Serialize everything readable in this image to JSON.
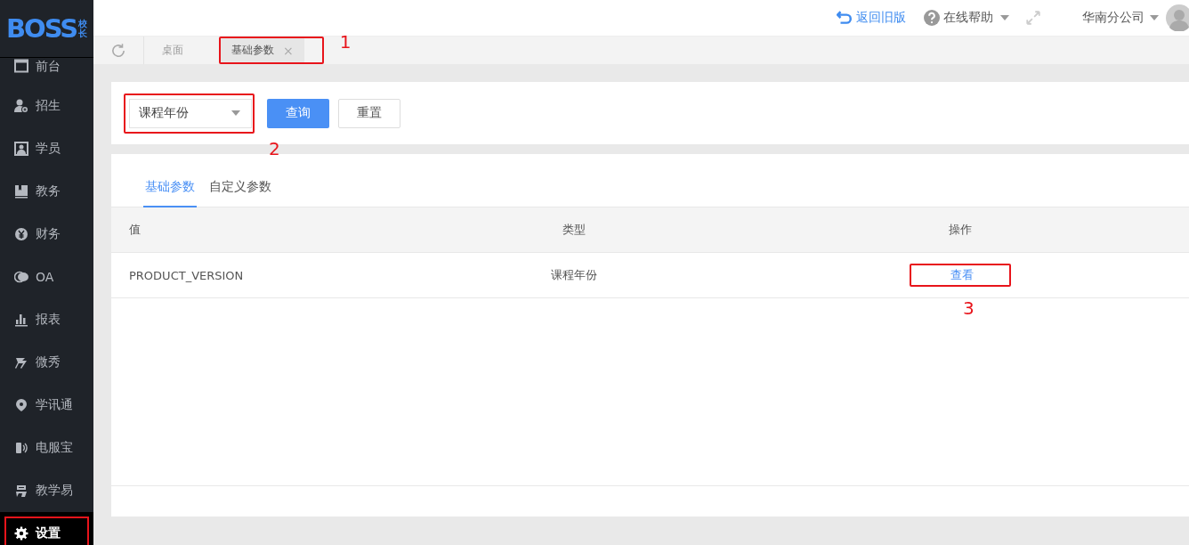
{
  "logo": {
    "text": "BOSS",
    "sub": "校长"
  },
  "sidebar": {
    "items": [
      {
        "label": "前台",
        "selected": false,
        "highlighted": false
      },
      {
        "label": "招生",
        "selected": false,
        "highlighted": false
      },
      {
        "label": "学员",
        "selected": false,
        "highlighted": false
      },
      {
        "label": "教务",
        "selected": false,
        "highlighted": false
      },
      {
        "label": "财务",
        "selected": false,
        "highlighted": false
      },
      {
        "label": "OA",
        "selected": false,
        "highlighted": false
      },
      {
        "label": "报表",
        "selected": false,
        "highlighted": false
      },
      {
        "label": "微秀",
        "selected": false,
        "highlighted": false
      },
      {
        "label": "学讯通",
        "selected": false,
        "highlighted": false
      },
      {
        "label": "电服宝",
        "selected": false,
        "highlighted": false
      },
      {
        "label": "教学易",
        "selected": false,
        "highlighted": false
      },
      {
        "label": "设置",
        "selected": true,
        "highlighted": true
      }
    ]
  },
  "header": {
    "back_link": "返回旧版",
    "help": "在线帮助",
    "company": "华南分公司"
  },
  "page_tabs": [
    {
      "label": "桌面",
      "selected": false,
      "closable": false,
      "highlighted": false
    },
    {
      "label": "基础参数",
      "selected": true,
      "closable": true,
      "close": "×",
      "highlighted": true,
      "callout": "1"
    }
  ],
  "filter": {
    "select": {
      "value": "课程年份",
      "highlighted": true,
      "callout": "2"
    },
    "query_button": "查询",
    "reset_button": "重置"
  },
  "tabs": [
    {
      "label": "基础参数",
      "selected": true
    },
    {
      "label": "自定义参数",
      "selected": false
    }
  ],
  "table": {
    "columns": [
      "值",
      "类型",
      "操作"
    ],
    "rows": [
      {
        "value": "PRODUCT_VERSION",
        "type": "课程年份",
        "action": "查看",
        "highlighted": true,
        "callout": "3"
      }
    ]
  }
}
